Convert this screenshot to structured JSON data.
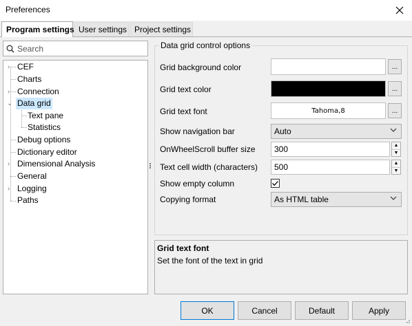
{
  "window": {
    "title": "Preferences"
  },
  "tabs": [
    "Program settings",
    "User settings",
    "Project settings"
  ],
  "search": {
    "placeholder": "Search"
  },
  "tree": {
    "items": [
      "CEF",
      "Charts",
      "Connection",
      "Data grid",
      "Text pane",
      "Statistics",
      "Debug options",
      "Dictionary editor",
      "Dimensional Analysis",
      "General",
      "Logging",
      "Paths"
    ],
    "selected": "Data grid"
  },
  "options": {
    "group_title": "Data grid control options",
    "bg_color_label": "Grid background color",
    "text_color_label": "Grid text color",
    "text_color_value": "#000000",
    "bg_color_value": "#ffffff",
    "font_label": "Grid text font",
    "font_value": "Tahoma,8",
    "nav_bar_label": "Show navigation bar",
    "nav_bar_value": "Auto",
    "wheel_label": "OnWheelScroll buffer size",
    "wheel_value": "300",
    "cell_width_label": "Text cell width (characters)",
    "cell_width_value": "500",
    "empty_col_label": "Show empty column",
    "empty_col_checked": true,
    "copy_label": "Copying format",
    "copy_value": "As HTML table",
    "browse_label": "..."
  },
  "description": {
    "title": "Grid text font",
    "text": "Set the font of the text in grid"
  },
  "buttons": {
    "ok": "OK",
    "cancel": "Cancel",
    "default": "Default",
    "apply": "Apply"
  }
}
